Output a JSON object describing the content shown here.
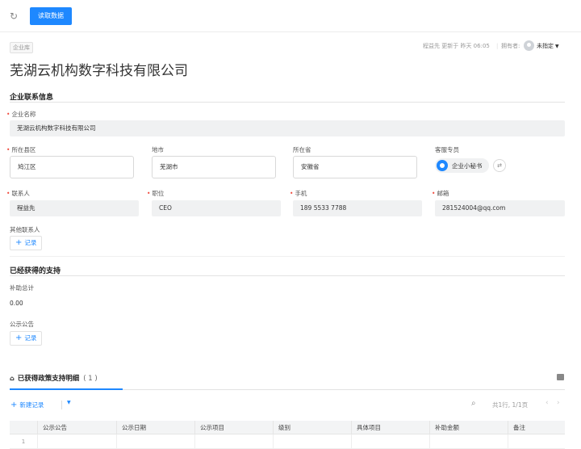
{
  "toolbar": {
    "refresh_icon": "refresh-icon",
    "read_data_label": "读取数据"
  },
  "record": {
    "tag": "企业库",
    "updated_by": "程益先 更新于 昨天 06:05",
    "owner_label": "拥有者:",
    "owner_name": "未指定",
    "title": "芜湖云机构数字科技有限公司"
  },
  "contact_section": {
    "title": "企业联系信息",
    "company_name_label": "企业名称",
    "company_name_value": "芜湖云机构数字科技有限公司",
    "district_label": "所在县区",
    "district_value": "鸠江区",
    "city_label": "地市",
    "city_value": "芜湖市",
    "province_label": "所在省",
    "province_value": "安徽省",
    "service_label": "客服专员",
    "service_value": "企业小秘书",
    "contact_label": "联系人",
    "contact_value": "程益先",
    "position_label": "职位",
    "position_value": "CEO",
    "phone_label": "手机",
    "phone_value": "189 5533 7788",
    "email_label": "邮箱",
    "email_value": "281524004@qq.com",
    "other_contacts_label": "其他联系人",
    "add_record_label": "记录"
  },
  "support_section": {
    "title": "已经获得的支持",
    "subsidy_total_label": "补助总计",
    "subsidy_total_value": "0.00",
    "announcement_label": "公示公告",
    "add_record_label": "记录"
  },
  "detail_tab": {
    "label": "已获得政策支持明细",
    "count": "( 1 )",
    "new_record_label": "新建记录",
    "pager_text": "共1行, 1/1页",
    "columns": [
      "公示公告",
      "公示日期",
      "公示项目",
      "级别",
      "具体项目",
      "补助金额",
      "备注"
    ],
    "rows": [
      {
        "index": "1"
      }
    ]
  },
  "colors": {
    "accent": "#1e88ff",
    "required": "#f04a3e"
  }
}
